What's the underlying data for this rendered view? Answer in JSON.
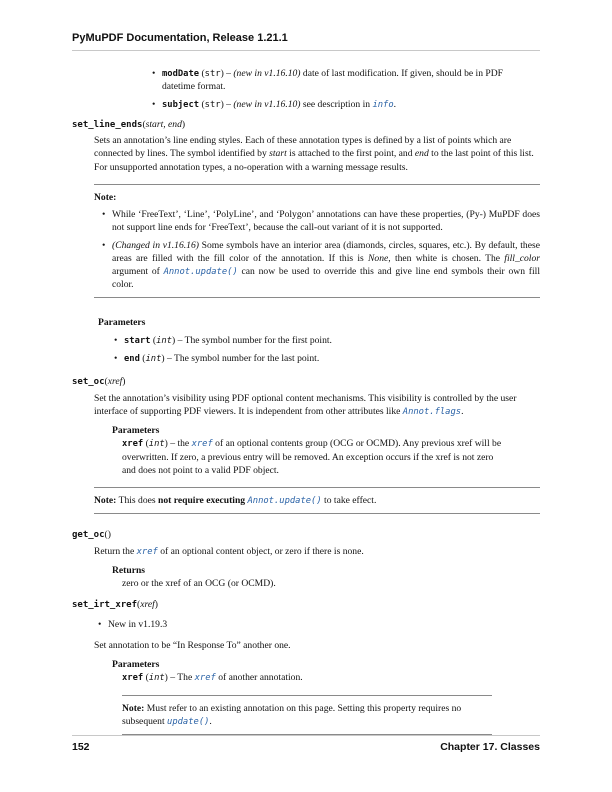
{
  "header": {
    "title": "PyMuPDF Documentation, Release 1.21.1"
  },
  "top_params": [
    {
      "name": "modDate",
      "type": "str",
      "note": "(new in v1.16.10)",
      "text": " date of last modification. If given, should be in PDF datetime format."
    },
    {
      "name": "subject",
      "type": "str",
      "note": "(new in v1.16.10)",
      "text_pre": " see description in ",
      "link": "info",
      "text_post": "."
    }
  ],
  "set_line_ends": {
    "name": "set_line_ends",
    "args": "start, end",
    "desc_1": "Sets an annotation’s line ending styles. Each of these annotation types is defined by a list of points which are connected by lines. The symbol identified by ",
    "desc_start": "start",
    "desc_2": " is attached to the first point, and ",
    "desc_end": "end",
    "desc_3": " to the last point of this list. For unsupported annotation types, a no-operation with a warning message results.",
    "note_title": "Note:",
    "note_b1": "While ‘FreeText’, ‘Line’, ‘PolyLine’, and ‘Polygon’ annotations can have these properties, (Py-) MuPDF does not support line ends for ‘FreeText’, because the call-out variant of it is not supported.",
    "note_b2_italic": "(Changed in v1.16.16)",
    "note_b2_a": " Some symbols have an interior area (diamonds, circles, squares, etc.). By default, these areas are filled with the fill color of the annotation. If this is ",
    "note_b2_none": "None",
    "note_b2_b": ", then white is chosen. The ",
    "note_b2_fill": "fill_color",
    "note_b2_c": " argument of ",
    "note_b2_link": "Annot.update()",
    "note_b2_d": " can now be used to override this and give line end symbols their own fill color.",
    "params_label": "Parameters",
    "params": [
      {
        "name": "start",
        "type": "int",
        "text": " – The symbol number for the first point."
      },
      {
        "name": "end",
        "type": "int",
        "text": " – The symbol number for the last point."
      }
    ]
  },
  "set_oc": {
    "name": "set_oc",
    "args": "xref",
    "desc_a": "Set the annotation’s visibility using PDF optional content mechanisms. This visibility is controlled by the user interface of supporting PDF viewers. It is independent from other attributes like ",
    "desc_link": "Annot.flags",
    "desc_b": ".",
    "params_label": "Parameters",
    "param_name": "xref",
    "param_type": "int",
    "param_a": " – the ",
    "param_link": "xref",
    "param_b": " of an optional contents group (OCG or OCMD). Any previous xref will be overwritten. If zero, a previous entry will be removed. An exception occurs if the xref is not zero and does not point to a valid PDF object.",
    "note_title": "Note:",
    "note_a": " This does ",
    "note_bold": "not require executing",
    "note_link": "Annot.update()",
    "note_b": " to take effect."
  },
  "get_oc": {
    "name": "get_oc",
    "args": "",
    "desc_a": "Return the ",
    "desc_link": "xref",
    "desc_b": " of an optional content object, or zero if there is none.",
    "returns_label": "Returns",
    "returns_text": "zero or the xref of an OCG (or OCMD)."
  },
  "set_irt_xref": {
    "name": "set_irt_xref",
    "args": "xref",
    "bullet": "New in v1.19.3",
    "desc": "Set annotation to be “In Response To” another one.",
    "params_label": "Parameters",
    "param_name": "xref",
    "param_type": "int",
    "param_a": " – The ",
    "param_link": "xref",
    "param_b": " of another annotation.",
    "note_title": "Note:",
    "note_a": " Must refer to an existing annotation on this page. Setting this property requires no subsequent ",
    "note_link": "update()",
    "note_b": "."
  },
  "footer": {
    "page_number": "152",
    "chapter": "Chapter 17.  Classes"
  }
}
